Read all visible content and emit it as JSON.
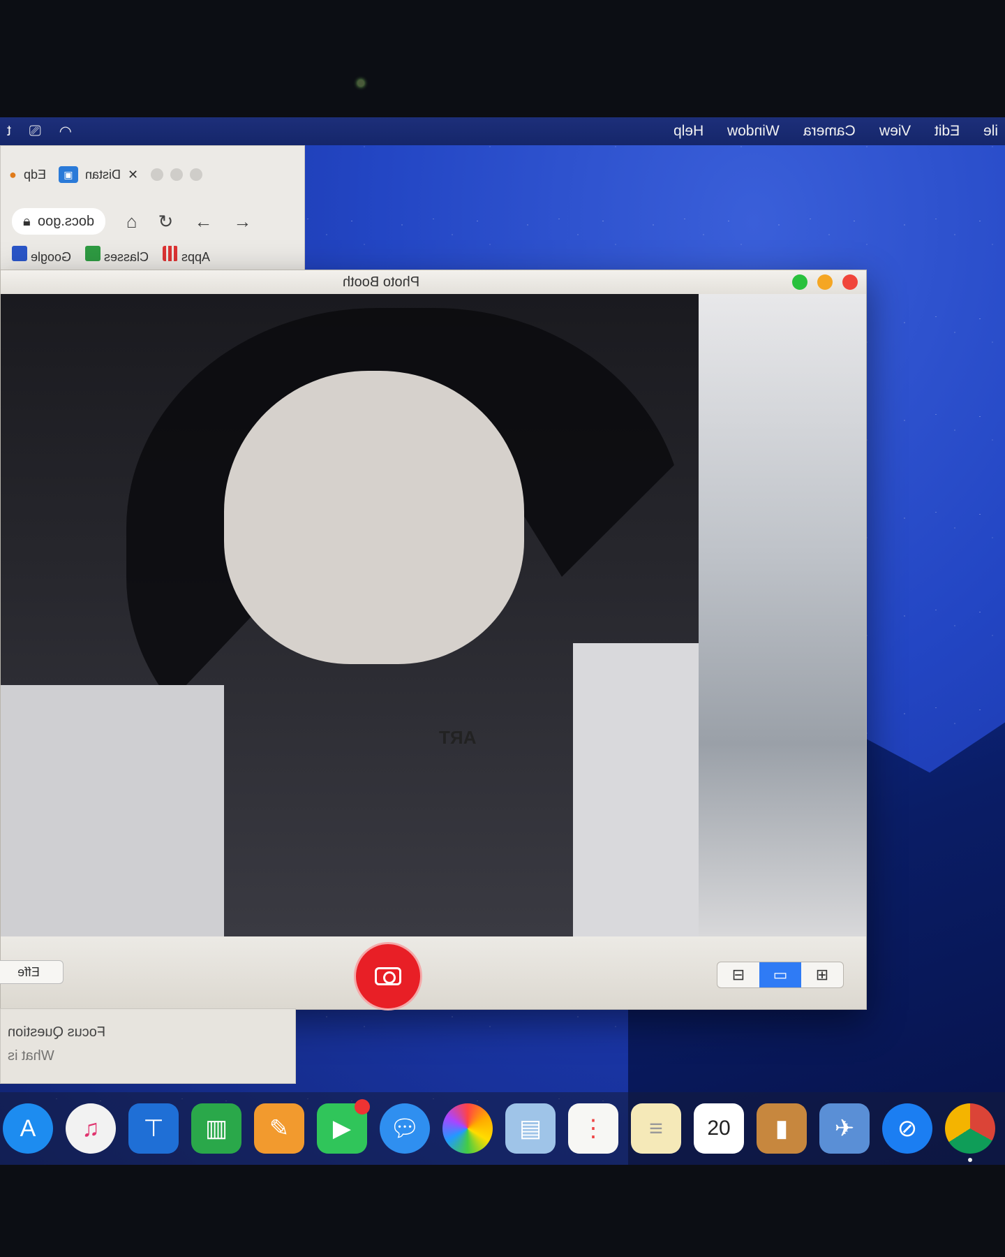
{
  "menubar": {
    "left_items": [
      "t"
    ],
    "right_items": [
      "ile",
      "Edit",
      "View",
      "Camera",
      "Window",
      "Help"
    ]
  },
  "browser": {
    "tabs": [
      {
        "title": "Distan"
      },
      {
        "title": "Edp"
      }
    ],
    "url": "docs.goo",
    "bookmarks": [
      "Apps",
      "Classes",
      "Google"
    ]
  },
  "photo_booth": {
    "title": "Photo Booth",
    "tattoo_text": "ART",
    "effects_label": "Effe",
    "modes": [
      "strip",
      "single",
      "grid"
    ],
    "active_mode": "single"
  },
  "doc_panel": {
    "line1": "Focus Question",
    "line2": "What is"
  },
  "dock": {
    "icons": [
      "app-store",
      "itunes",
      "keynote",
      "numbers",
      "pages",
      "facetime",
      "messages",
      "photos",
      "preview",
      "reminders",
      "notes",
      "calendar",
      "contacts",
      "preview-2",
      "safari",
      "chrome"
    ],
    "calendar_day": "20"
  },
  "colors": {
    "desktop": "#2346c4",
    "close": "#f0453a",
    "minimize": "#f5a623",
    "zoom": "#29c13d",
    "shutter": "#e81f26",
    "mode_active": "#2f7bf5"
  }
}
